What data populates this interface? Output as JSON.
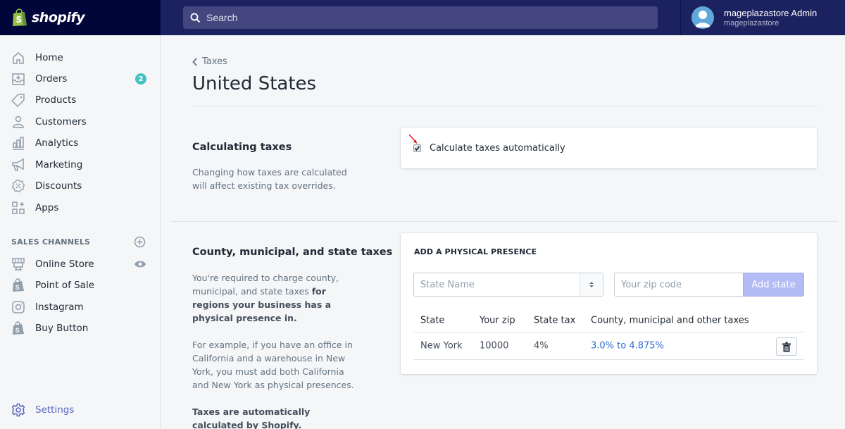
{
  "topbar": {
    "brand": "shopify",
    "search_placeholder": "Search",
    "user_name": "mageplazastore Admin",
    "store_name": "mageplazastore"
  },
  "sidebar": {
    "items": [
      {
        "label": "Home",
        "icon": "home-icon"
      },
      {
        "label": "Orders",
        "icon": "orders-icon",
        "badge": "2"
      },
      {
        "label": "Products",
        "icon": "tag-icon"
      },
      {
        "label": "Customers",
        "icon": "person-icon"
      },
      {
        "label": "Analytics",
        "icon": "bar-chart-icon"
      },
      {
        "label": "Marketing",
        "icon": "megaphone-icon"
      },
      {
        "label": "Discounts",
        "icon": "discount-icon"
      },
      {
        "label": "Apps",
        "icon": "apps-icon"
      }
    ],
    "sales_channels_title": "SALES CHANNELS",
    "channels": [
      {
        "label": "Online Store",
        "icon": "store-icon"
      },
      {
        "label": "Point of Sale",
        "icon": "shopify-bag-icon"
      },
      {
        "label": "Instagram",
        "icon": "instagram-icon"
      },
      {
        "label": "Buy Button",
        "icon": "shopify-bag-icon"
      }
    ],
    "settings_label": "Settings",
    "accent": "#5c6ac4",
    "badge_color": "#47c1bf"
  },
  "main": {
    "breadcrumb": "Taxes",
    "title": "United States",
    "calculating": {
      "heading": "Calculating taxes",
      "description": "Changing how taxes are calculated will affect existing tax overrides.",
      "checkbox_label": "Calculate taxes automatically",
      "checked": true
    },
    "county": {
      "heading": "County, municipal, and state taxes",
      "desc1_plain": "You're required to charge county, municipal, and state taxes ",
      "desc1_bold": "for regions your business has a physical presence in.",
      "desc2": "For example, if you have an office in California and a warehouse in New York, you must add both California and New York as physical presences.",
      "desc3_bold": "Taxes are automatically calculated by Shopify."
    },
    "presence": {
      "title": "ADD A PHYSICAL PRESENCE",
      "state_placeholder": "State Name",
      "zip_placeholder": "Your zip code",
      "add_button": "Add state",
      "columns": [
        "State",
        "Your zip",
        "State tax",
        "County, municipal and other taxes"
      ],
      "rows": [
        {
          "state": "New York",
          "zip": "10000",
          "state_tax": "4%",
          "other_taxes": "3.0% to 4.875%"
        }
      ]
    }
  }
}
